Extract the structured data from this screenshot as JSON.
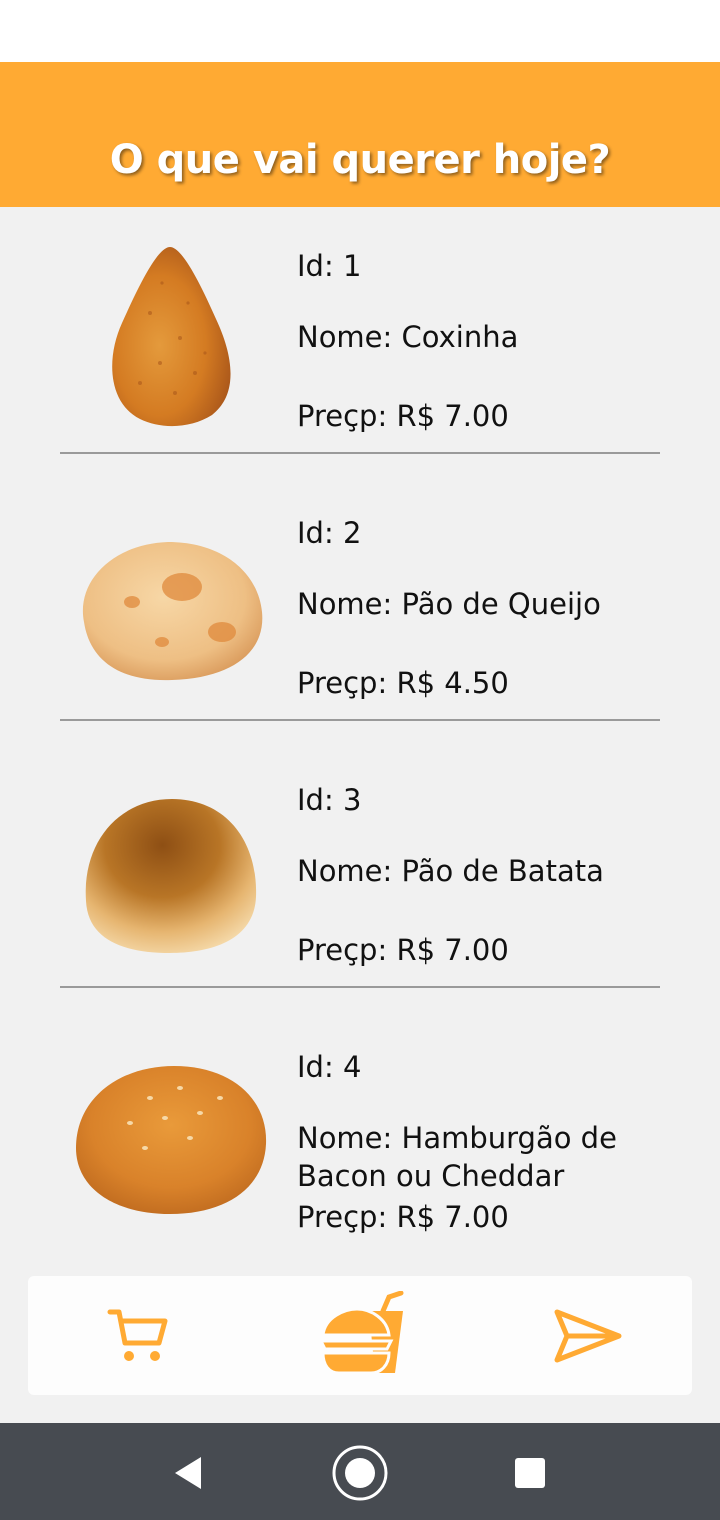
{
  "header": {
    "title": "O que vai querer hoje?"
  },
  "products": [
    {
      "id_text": "Id: 1",
      "name_text": "Nome: Coxinha",
      "price_text": "Preçp: R$ 7.00",
      "image": "coxinha-image"
    },
    {
      "id_text": "Id: 2",
      "name_text": "Nome: Pão de Queijo",
      "price_text": "Preçp: R$ 4.50",
      "image": "pao-de-queijo-image"
    },
    {
      "id_text": "Id: 3",
      "name_text": "Nome: Pão de Batata",
      "price_text": "Preçp: R$ 7.00",
      "image": "pao-de-batata-image"
    },
    {
      "id_text": "Id: 4",
      "name_text": "Nome: Hamburgão de Bacon ou Cheddar",
      "price_text": "Preçp: R$ 7.00",
      "image": "hamburgao-image"
    }
  ],
  "bottom_nav": {
    "items": [
      "cart-icon",
      "burger-drink-icon",
      "send-icon"
    ],
    "accent": "#ffaa33"
  },
  "system_nav": {
    "items": [
      "back-icon",
      "home-icon",
      "recents-icon"
    ]
  },
  "colors": {
    "header_bg": "#ffaa33",
    "list_bg": "#f1f1f1",
    "nav_bg": "#474b51"
  }
}
